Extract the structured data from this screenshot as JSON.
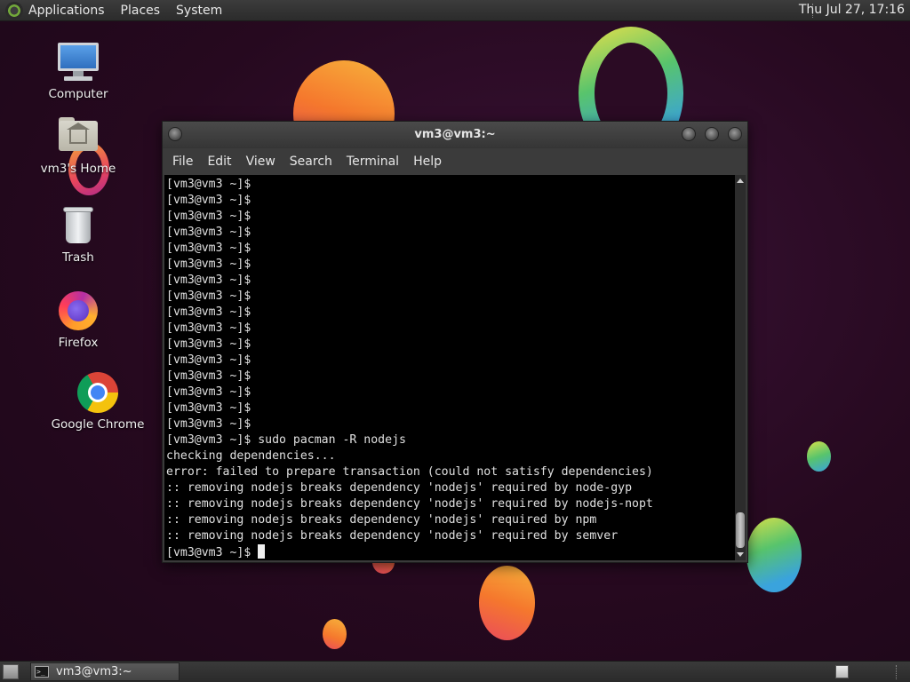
{
  "top_panel": {
    "menus": [
      "Applications",
      "Places",
      "System"
    ],
    "clock": "Thu Jul 27, 17:16"
  },
  "desktop_icons": [
    {
      "label": "Computer",
      "icon": "computer-icon"
    },
    {
      "label": "vm3's Home",
      "icon": "home-folder-icon"
    },
    {
      "label": "Trash",
      "icon": "trash-icon"
    },
    {
      "label": "Firefox",
      "icon": "firefox-icon"
    },
    {
      "label": "Google Chrome",
      "icon": "chrome-icon"
    }
  ],
  "terminal": {
    "title": "vm3@vm3:~",
    "menus": [
      "File",
      "Edit",
      "View",
      "Search",
      "Terminal",
      "Help"
    ],
    "lines": [
      "[vm3@vm3 ~]$",
      "[vm3@vm3 ~]$",
      "[vm3@vm3 ~]$",
      "[vm3@vm3 ~]$",
      "[vm3@vm3 ~]$",
      "[vm3@vm3 ~]$",
      "[vm3@vm3 ~]$",
      "[vm3@vm3 ~]$",
      "[vm3@vm3 ~]$",
      "[vm3@vm3 ~]$",
      "[vm3@vm3 ~]$",
      "[vm3@vm3 ~]$",
      "[vm3@vm3 ~]$",
      "[vm3@vm3 ~]$",
      "[vm3@vm3 ~]$",
      "[vm3@vm3 ~]$",
      "[vm3@vm3 ~]$ sudo pacman -R nodejs",
      "checking dependencies...",
      "error: failed to prepare transaction (could not satisfy dependencies)",
      ":: removing nodejs breaks dependency 'nodejs' required by node-gyp",
      ":: removing nodejs breaks dependency 'nodejs' required by nodejs-nopt",
      ":: removing nodejs breaks dependency 'nodejs' required by npm",
      ":: removing nodejs breaks dependency 'nodejs' required by semver"
    ],
    "prompt": "[vm3@vm3 ~]$ "
  },
  "taskbar": {
    "task_label": "vm3@vm3:~"
  }
}
